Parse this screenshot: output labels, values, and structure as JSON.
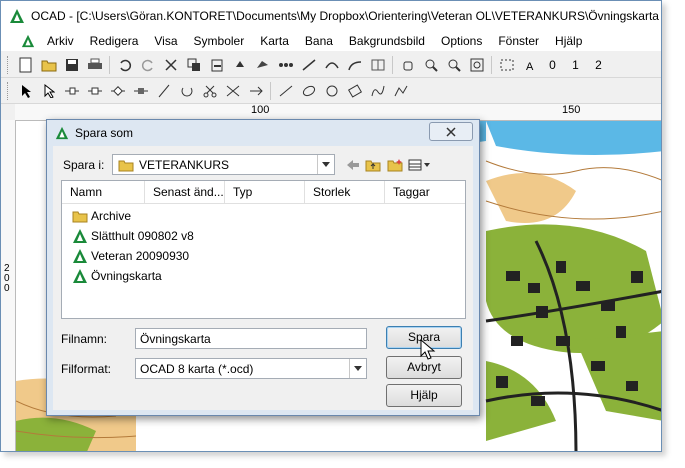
{
  "window": {
    "title": "OCAD - [C:\\Users\\Göran.KONTORET\\Documents\\My Dropbox\\Orientering\\Veteran OL\\VETERANKURS\\Övningskarta"
  },
  "menu": [
    "Arkiv",
    "Redigera",
    "Visa",
    "Symboler",
    "Karta",
    "Bana",
    "Bakgrundsbild",
    "Options",
    "Fönster",
    "Hjälp"
  ],
  "toolbar": {
    "labels": [
      "0",
      "1",
      "2"
    ]
  },
  "ruler": {
    "marks": [
      "100",
      "150"
    ],
    "vertical_label": "2\n0\n0"
  },
  "dialog": {
    "title": "Spara som",
    "save_in_label": "Spara i:",
    "save_in_value": "VETERANKURS",
    "columns": [
      "Namn",
      "Senast änd...",
      "Typ",
      "Storlek",
      "Taggar"
    ],
    "files": [
      {
        "name": "Archive",
        "icon": "folder-icon"
      },
      {
        "name": "Slätthult 090802 v8",
        "icon": "ocad-file-icon"
      },
      {
        "name": "Veteran 20090930",
        "icon": "ocad-file-icon"
      },
      {
        "name": "Övningskarta",
        "icon": "ocad-file-icon"
      }
    ],
    "filename_label": "Filnamn:",
    "filename_value": "Övningskarta",
    "format_label": "Filformat:",
    "format_value": "OCAD 8 karta (*.ocd)",
    "buttons": {
      "save": "Spara",
      "cancel": "Avbryt",
      "help": "Hjälp"
    }
  },
  "colors": {
    "accent": "#3c7fb1",
    "map_green": "#8bb23a",
    "map_blue": "#5bb8e6",
    "map_orange": "#f0c98a"
  }
}
